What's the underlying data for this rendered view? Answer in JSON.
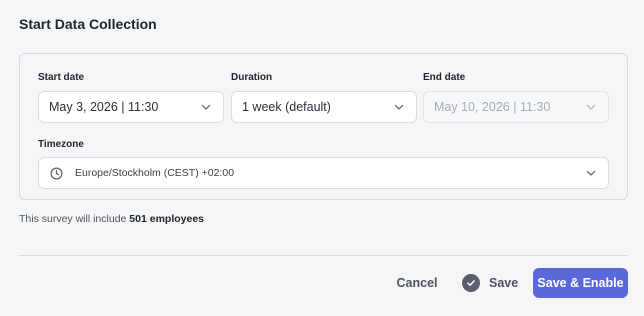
{
  "dialog": {
    "title": "Start Data Collection"
  },
  "form": {
    "start_date": {
      "label": "Start date",
      "value": "May 3, 2026 | 11:30",
      "icon": "chevron-down-icon"
    },
    "duration": {
      "label": "Duration",
      "value": "1 week (default)",
      "icon": "chevron-down-icon"
    },
    "end_date": {
      "label": "End date",
      "value": "May 10, 2026 | 11:30",
      "disabled": true,
      "icon": "chevron-down-icon"
    },
    "timezone": {
      "label": "Timezone",
      "value": "Europe/Stockholm (CEST) +02:00",
      "icon": "clock-icon"
    }
  },
  "summary": {
    "prefix": "This survey will include ",
    "count_text": "501 employees"
  },
  "actions": {
    "cancel_label": "Cancel",
    "save_label": "Save",
    "save_enable_label": "Save & Enable"
  },
  "colors": {
    "primary": "#5b68d9",
    "background": "#f5f6f8",
    "text": "#1f2430",
    "muted_text": "#4d5360",
    "disabled_text": "#a6abb5",
    "border": "#d6dae1"
  }
}
